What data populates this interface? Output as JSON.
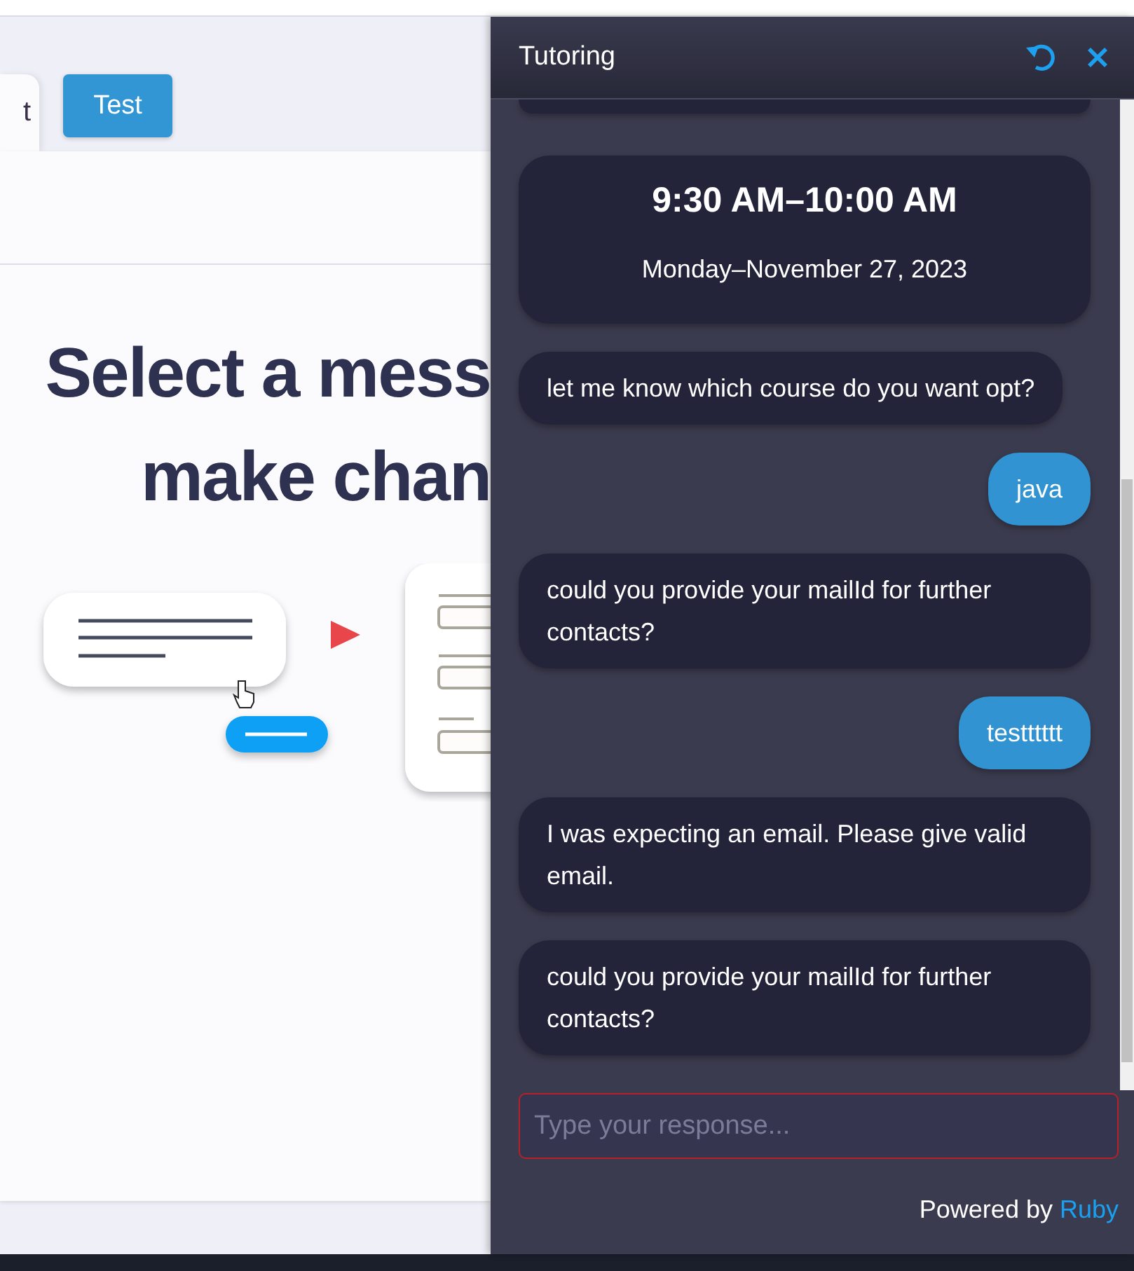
{
  "tabs": [
    {
      "label": "t",
      "selected": true
    }
  ],
  "test_button": "Test",
  "heading_lines": [
    "Select a mess",
    "make chan"
  ],
  "chat": {
    "title": "Tutoring",
    "messages": [
      {
        "kind": "partial"
      },
      {
        "kind": "time",
        "time": "9:30 AM–10:00 AM",
        "date": "Monday–November 27, 2023"
      },
      {
        "kind": "bot",
        "text": "let me know which course do you want opt?"
      },
      {
        "kind": "user",
        "text": "java"
      },
      {
        "kind": "bot",
        "text": "could you provide your mailId for further contacts?"
      },
      {
        "kind": "user",
        "text": "testttttt"
      },
      {
        "kind": "bot",
        "text": "I was expecting an email. Please give valid email."
      },
      {
        "kind": "bot",
        "text": "could you provide your mailId for further contacts?"
      }
    ],
    "input": {
      "placeholder": "Type your response..."
    },
    "footer": {
      "prefix": "Powered by",
      "brand": "Ruby"
    }
  }
}
